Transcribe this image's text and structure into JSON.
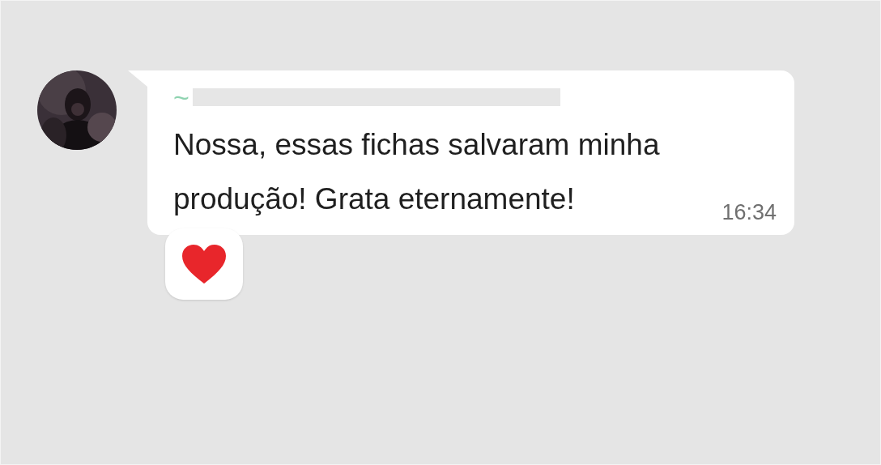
{
  "message": {
    "sender": "~",
    "sender_redacted": true,
    "text": "Nossa, essas fichas salvaram minha produção! Grata eternamente!",
    "time": "16:34",
    "reaction": {
      "kind": "heart"
    }
  }
}
